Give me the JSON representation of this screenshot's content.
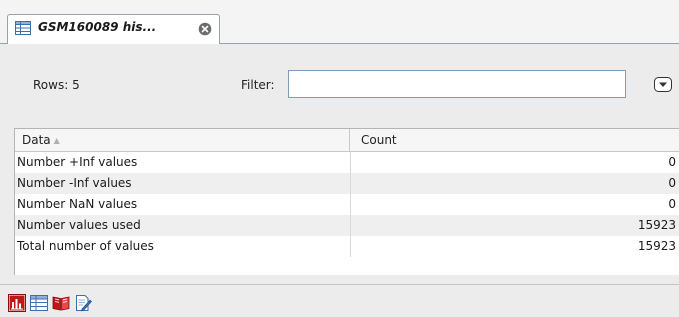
{
  "tab": {
    "title": "GSM160089 his...",
    "icon": "table-icon",
    "close_icon": "close-circle-icon"
  },
  "toolbar": {
    "rows_text": "Rows: 5",
    "filter_label": "Filter:",
    "filter_value": "",
    "options_icon": "dropdown-options-icon"
  },
  "table": {
    "columns": [
      {
        "label": "Data",
        "sorted": "ascending"
      },
      {
        "label": "Count"
      }
    ],
    "rows": [
      {
        "label": "Number +Inf values",
        "value": "0"
      },
      {
        "label": "Number -Inf values",
        "value": "0"
      },
      {
        "label": "Number NaN values",
        "value": "0"
      },
      {
        "label": "Number values used",
        "value": "15923"
      },
      {
        "label": "Total number of values",
        "value": "15923"
      }
    ]
  },
  "bottom_bar": {
    "buttons": [
      {
        "icon": "bar-chart-icon"
      },
      {
        "icon": "table-view-icon"
      },
      {
        "icon": "book-icon"
      },
      {
        "icon": "edit-document-icon"
      }
    ]
  },
  "colors": {
    "panel_bg": "#ececec",
    "row_alt_bg": "#efefef",
    "border": "#9aa0a8",
    "input_border": "#7f9db9",
    "icon_red": "#c01818",
    "icon_blue": "#3a6fb0"
  }
}
